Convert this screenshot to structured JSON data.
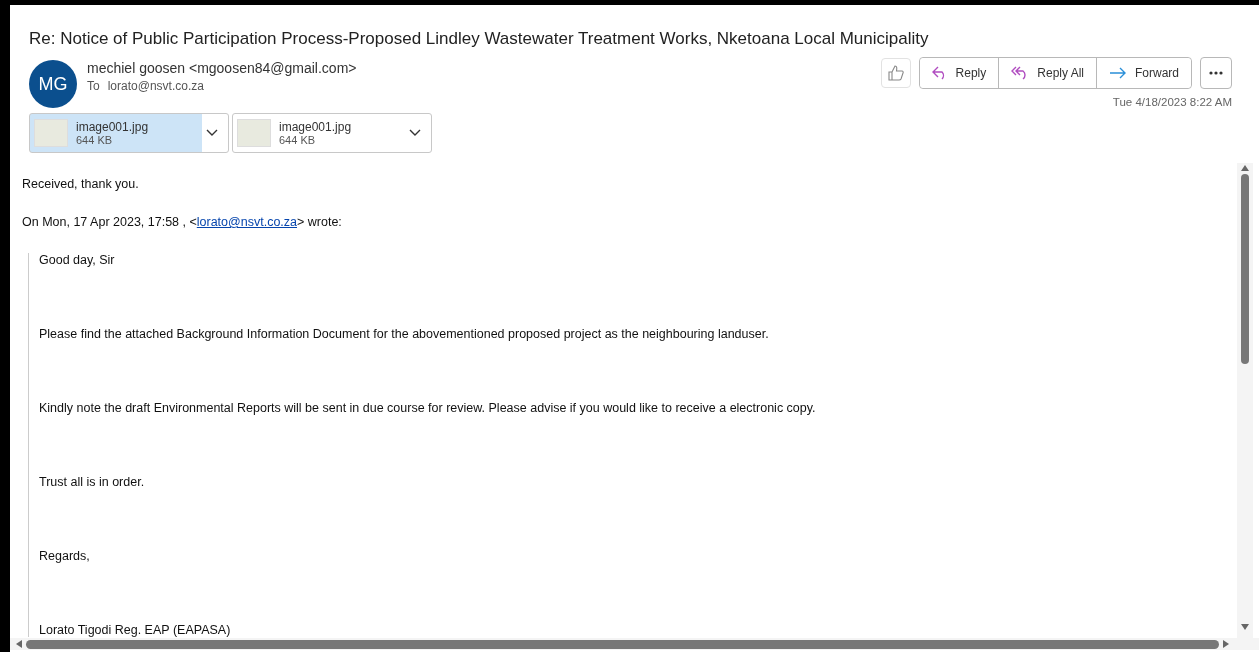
{
  "subject": "Re: Notice of Public Participation Process-Proposed Lindley Wastewater Treatment Works, Nketoana Local Municipality",
  "sender": {
    "initials": "MG",
    "name": "mechiel goosen <mgoosen84@gmail.com>",
    "to_label": "To",
    "to": "lorato@nsvt.co.za"
  },
  "actions": [
    {
      "kind": "reply",
      "label": "Reply"
    },
    {
      "kind": "reply_all",
      "label": "Reply All"
    },
    {
      "kind": "forward",
      "label": "Forward"
    }
  ],
  "date": "Tue 4/18/2023 8:22 AM",
  "attachments": [
    {
      "name": "image001.jpg",
      "size": "644 KB",
      "selected": true
    },
    {
      "name": "image001.jpg",
      "size": "644 KB",
      "selected": false
    }
  ],
  "body": {
    "reply": "Received, thank you.",
    "quote_intro_before": "On Mon, 17 Apr 2023, 17:58 , <",
    "quote_link": "lorato@nsvt.co.za",
    "quote_intro_after": "> wrote:",
    "quoted": [
      "Good day, Sir",
      "Please find the attached Background Information Document for the abovementioned proposed project as the neighbouring landuser.",
      "Kindly note the draft Environmental Reports will be sent in due course for review. Please advise if you would like to receive a electronic copy.",
      "Trust all is in order.",
      "Regards,",
      "Lorato Tigodi Reg. EAP (EAPASA)"
    ]
  }
}
